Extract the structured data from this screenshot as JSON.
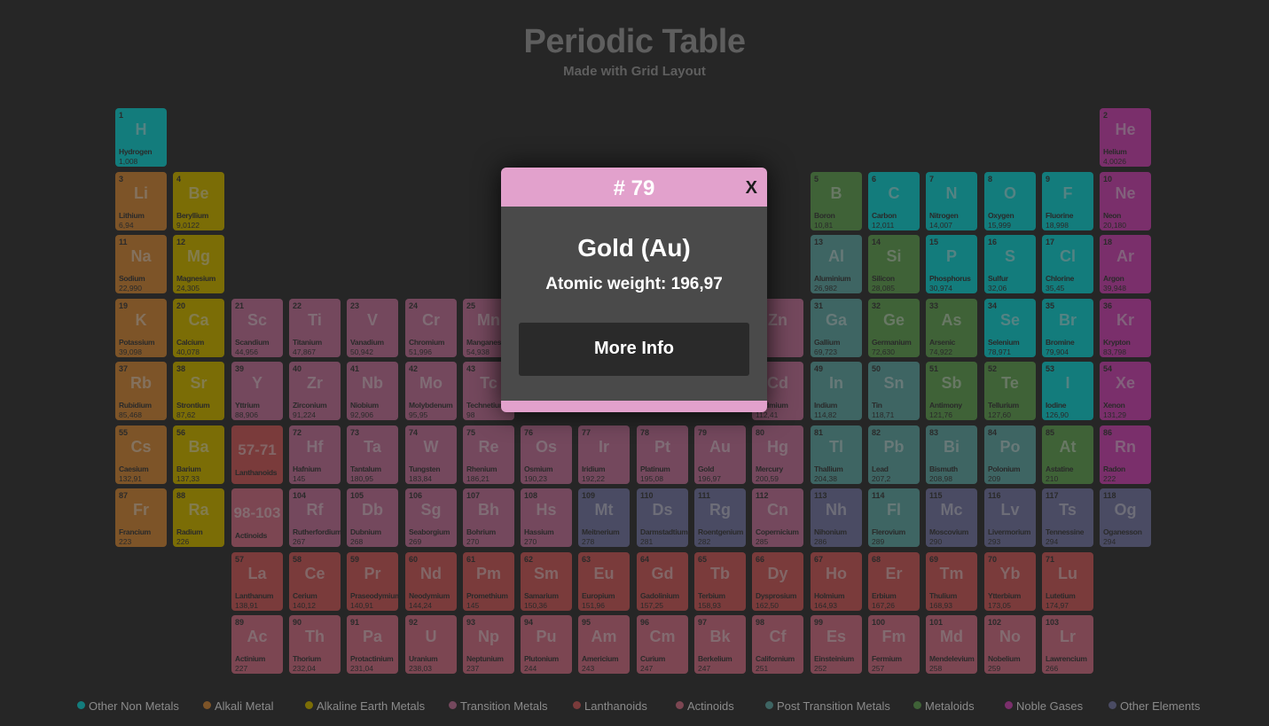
{
  "header": {
    "title": "Periodic Table",
    "subtitle": "Made with Grid Layout"
  },
  "colors": {
    "nonmetal": "#137c7c",
    "alkali": "#7d5428",
    "alkearth": "#7b6d06",
    "transition": "#74485d",
    "lanth": "#7a3b3b",
    "actin": "#7c4652",
    "posttrans": "#3e6563",
    "metalloid": "#3f6237",
    "noble": "#7a2f6b",
    "other": "#4a4b63",
    "modal_accent": "#e2a1cc"
  },
  "elements": [
    {
      "n": "1",
      "s": "H",
      "name": "Hydrogen",
      "w": "1,008",
      "col": 1,
      "row": 1,
      "cat": "nonmetal"
    },
    {
      "n": "2",
      "s": "He",
      "name": "Helium",
      "w": "4,0026",
      "col": 18,
      "row": 1,
      "cat": "noble"
    },
    {
      "n": "3",
      "s": "Li",
      "name": "Lithium",
      "w": "6,94",
      "col": 1,
      "row": 2,
      "cat": "alkali"
    },
    {
      "n": "4",
      "s": "Be",
      "name": "Beryllium",
      "w": "9,0122",
      "col": 2,
      "row": 2,
      "cat": "alkearth"
    },
    {
      "n": "5",
      "s": "B",
      "name": "Boron",
      "w": "10,81",
      "col": 13,
      "row": 2,
      "cat": "metalloid"
    },
    {
      "n": "6",
      "s": "C",
      "name": "Carbon",
      "w": "12,011",
      "col": 14,
      "row": 2,
      "cat": "nonmetal"
    },
    {
      "n": "7",
      "s": "N",
      "name": "Nitrogen",
      "w": "14,007",
      "col": 15,
      "row": 2,
      "cat": "nonmetal"
    },
    {
      "n": "8",
      "s": "O",
      "name": "Oxygen",
      "w": "15,999",
      "col": 16,
      "row": 2,
      "cat": "nonmetal"
    },
    {
      "n": "9",
      "s": "F",
      "name": "Fluorine",
      "w": "18,998",
      "col": 17,
      "row": 2,
      "cat": "nonmetal"
    },
    {
      "n": "10",
      "s": "Ne",
      "name": "Neon",
      "w": "20,180",
      "col": 18,
      "row": 2,
      "cat": "noble"
    },
    {
      "n": "11",
      "s": "Na",
      "name": "Sodium",
      "w": "22,990",
      "col": 1,
      "row": 3,
      "cat": "alkali"
    },
    {
      "n": "12",
      "s": "Mg",
      "name": "Magnesium",
      "w": "24,305",
      "col": 2,
      "row": 3,
      "cat": "alkearth"
    },
    {
      "n": "13",
      "s": "Al",
      "name": "Aluminium",
      "w": "26,982",
      "col": 13,
      "row": 3,
      "cat": "posttrans"
    },
    {
      "n": "14",
      "s": "Si",
      "name": "Silicon",
      "w": "28,085",
      "col": 14,
      "row": 3,
      "cat": "metalloid"
    },
    {
      "n": "15",
      "s": "P",
      "name": "Phosphorus",
      "w": "30,974",
      "col": 15,
      "row": 3,
      "cat": "nonmetal"
    },
    {
      "n": "16",
      "s": "S",
      "name": "Sulfur",
      "w": "32,06",
      "col": 16,
      "row": 3,
      "cat": "nonmetal"
    },
    {
      "n": "17",
      "s": "Cl",
      "name": "Chlorine",
      "w": "35,45",
      "col": 17,
      "row": 3,
      "cat": "nonmetal"
    },
    {
      "n": "18",
      "s": "Ar",
      "name": "Argon",
      "w": "39,948",
      "col": 18,
      "row": 3,
      "cat": "noble"
    },
    {
      "n": "19",
      "s": "K",
      "name": "Potassium",
      "w": "39,098",
      "col": 1,
      "row": 4,
      "cat": "alkali"
    },
    {
      "n": "20",
      "s": "Ca",
      "name": "Calcium",
      "w": "40,078",
      "col": 2,
      "row": 4,
      "cat": "alkearth"
    },
    {
      "n": "21",
      "s": "Sc",
      "name": "Scandium",
      "w": "44,956",
      "col": 3,
      "row": 4,
      "cat": "transition"
    },
    {
      "n": "22",
      "s": "Ti",
      "name": "Titanium",
      "w": "47,867",
      "col": 4,
      "row": 4,
      "cat": "transition"
    },
    {
      "n": "23",
      "s": "V",
      "name": "Vanadium",
      "w": "50,942",
      "col": 5,
      "row": 4,
      "cat": "transition"
    },
    {
      "n": "24",
      "s": "Cr",
      "name": "Chromium",
      "w": "51,996",
      "col": 6,
      "row": 4,
      "cat": "transition"
    },
    {
      "n": "25",
      "s": "Mn",
      "name": "Manganese",
      "w": "54,938",
      "col": 7,
      "row": 4,
      "cat": "transition"
    },
    {
      "n": "30",
      "s": "Zn",
      "name": "",
      "w": "",
      "col": 12,
      "row": 4,
      "cat": "transition"
    },
    {
      "n": "31",
      "s": "Ga",
      "name": "Gallium",
      "w": "69,723",
      "col": 13,
      "row": 4,
      "cat": "posttrans"
    },
    {
      "n": "32",
      "s": "Ge",
      "name": "Germanium",
      "w": "72,630",
      "col": 14,
      "row": 4,
      "cat": "metalloid"
    },
    {
      "n": "33",
      "s": "As",
      "name": "Arsenic",
      "w": "74,922",
      "col": 15,
      "row": 4,
      "cat": "metalloid"
    },
    {
      "n": "34",
      "s": "Se",
      "name": "Selenium",
      "w": "78,971",
      "col": 16,
      "row": 4,
      "cat": "nonmetal"
    },
    {
      "n": "35",
      "s": "Br",
      "name": "Bromine",
      "w": "79,904",
      "col": 17,
      "row": 4,
      "cat": "nonmetal"
    },
    {
      "n": "36",
      "s": "Kr",
      "name": "Krypton",
      "w": "83,798",
      "col": 18,
      "row": 4,
      "cat": "noble"
    },
    {
      "n": "37",
      "s": "Rb",
      "name": "Rubidium",
      "w": "85,468",
      "col": 1,
      "row": 5,
      "cat": "alkali"
    },
    {
      "n": "38",
      "s": "Sr",
      "name": "Strontium",
      "w": "87,62",
      "col": 2,
      "row": 5,
      "cat": "alkearth"
    },
    {
      "n": "39",
      "s": "Y",
      "name": "Yttrium",
      "w": "88,906",
      "col": 3,
      "row": 5,
      "cat": "transition"
    },
    {
      "n": "40",
      "s": "Zr",
      "name": "Zirconium",
      "w": "91,224",
      "col": 4,
      "row": 5,
      "cat": "transition"
    },
    {
      "n": "41",
      "s": "Nb",
      "name": "Niobium",
      "w": "92,906",
      "col": 5,
      "row": 5,
      "cat": "transition"
    },
    {
      "n": "42",
      "s": "Mo",
      "name": "Molybdenum",
      "w": "95,95",
      "col": 6,
      "row": 5,
      "cat": "transition"
    },
    {
      "n": "43",
      "s": "Tc",
      "name": "Technetium",
      "w": "98",
      "col": 7,
      "row": 5,
      "cat": "transition"
    },
    {
      "n": "48",
      "s": "Cd",
      "name": "Cadmium",
      "w": "112,41",
      "col": 12,
      "row": 5,
      "cat": "transition"
    },
    {
      "n": "49",
      "s": "In",
      "name": "Indium",
      "w": "114,82",
      "col": 13,
      "row": 5,
      "cat": "posttrans"
    },
    {
      "n": "50",
      "s": "Sn",
      "name": "Tin",
      "w": "118,71",
      "col": 14,
      "row": 5,
      "cat": "posttrans"
    },
    {
      "n": "51",
      "s": "Sb",
      "name": "Antimony",
      "w": "121,76",
      "col": 15,
      "row": 5,
      "cat": "metalloid"
    },
    {
      "n": "52",
      "s": "Te",
      "name": "Tellurium",
      "w": "127,60",
      "col": 16,
      "row": 5,
      "cat": "metalloid"
    },
    {
      "n": "53",
      "s": "I",
      "name": "Iodine",
      "w": "126,90",
      "col": 17,
      "row": 5,
      "cat": "nonmetal"
    },
    {
      "n": "54",
      "s": "Xe",
      "name": "Xenon",
      "w": "131,29",
      "col": 18,
      "row": 5,
      "cat": "noble"
    },
    {
      "n": "55",
      "s": "Cs",
      "name": "Caesium",
      "w": "132,91",
      "col": 1,
      "row": 6,
      "cat": "alkali"
    },
    {
      "n": "56",
      "s": "Ba",
      "name": "Barium",
      "w": "137,33",
      "col": 2,
      "row": 6,
      "cat": "alkearth"
    },
    {
      "n": "",
      "s": "57-71",
      "name": "Lanthanoids",
      "w": "",
      "col": 3,
      "row": 6,
      "cat": "lanth",
      "range": true
    },
    {
      "n": "72",
      "s": "Hf",
      "name": "Hafnium",
      "w": "145",
      "col": 4,
      "row": 6,
      "cat": "transition"
    },
    {
      "n": "73",
      "s": "Ta",
      "name": "Tantalum",
      "w": "180,95",
      "col": 5,
      "row": 6,
      "cat": "transition"
    },
    {
      "n": "74",
      "s": "W",
      "name": "Tungsten",
      "w": "183,84",
      "col": 6,
      "row": 6,
      "cat": "transition"
    },
    {
      "n": "75",
      "s": "Re",
      "name": "Rhenium",
      "w": "186,21",
      "col": 7,
      "row": 6,
      "cat": "transition"
    },
    {
      "n": "76",
      "s": "Os",
      "name": "Osmium",
      "w": "190,23",
      "col": 8,
      "row": 6,
      "cat": "transition"
    },
    {
      "n": "77",
      "s": "Ir",
      "name": "Iridium",
      "w": "192,22",
      "col": 9,
      "row": 6,
      "cat": "transition"
    },
    {
      "n": "78",
      "s": "Pt",
      "name": "Platinum",
      "w": "195,08",
      "col": 10,
      "row": 6,
      "cat": "transition"
    },
    {
      "n": "79",
      "s": "Au",
      "name": "Gold",
      "w": "196,97",
      "col": 11,
      "row": 6,
      "cat": "transition"
    },
    {
      "n": "80",
      "s": "Hg",
      "name": "Mercury",
      "w": "200,59",
      "col": 12,
      "row": 6,
      "cat": "transition"
    },
    {
      "n": "81",
      "s": "Tl",
      "name": "Thallium",
      "w": "204,38",
      "col": 13,
      "row": 6,
      "cat": "posttrans"
    },
    {
      "n": "82",
      "s": "Pb",
      "name": "Lead",
      "w": "207,2",
      "col": 14,
      "row": 6,
      "cat": "posttrans"
    },
    {
      "n": "83",
      "s": "Bi",
      "name": "Bismuth",
      "w": "208,98",
      "col": 15,
      "row": 6,
      "cat": "posttrans"
    },
    {
      "n": "84",
      "s": "Po",
      "name": "Polonium",
      "w": "209",
      "col": 16,
      "row": 6,
      "cat": "posttrans"
    },
    {
      "n": "85",
      "s": "At",
      "name": "Astatine",
      "w": "210",
      "col": 17,
      "row": 6,
      "cat": "metalloid"
    },
    {
      "n": "86",
      "s": "Rn",
      "name": "Radon",
      "w": "222",
      "col": 18,
      "row": 6,
      "cat": "noble"
    },
    {
      "n": "87",
      "s": "Fr",
      "name": "Francium",
      "w": "223",
      "col": 1,
      "row": 7,
      "cat": "alkali"
    },
    {
      "n": "88",
      "s": "Ra",
      "name": "Radium",
      "w": "226",
      "col": 2,
      "row": 7,
      "cat": "alkearth"
    },
    {
      "n": "",
      "s": "98-103",
      "name": "Actinoids",
      "w": "",
      "col": 3,
      "row": 7,
      "cat": "actin",
      "range": true
    },
    {
      "n": "104",
      "s": "Rf",
      "name": "Rutherfordium",
      "w": "267",
      "col": 4,
      "row": 7,
      "cat": "transition"
    },
    {
      "n": "105",
      "s": "Db",
      "name": "Dubnium",
      "w": "268",
      "col": 5,
      "row": 7,
      "cat": "transition"
    },
    {
      "n": "106",
      "s": "Sg",
      "name": "Seaborgium",
      "w": "269",
      "col": 6,
      "row": 7,
      "cat": "transition"
    },
    {
      "n": "107",
      "s": "Bh",
      "name": "Bohrium",
      "w": "270",
      "col": 7,
      "row": 7,
      "cat": "transition"
    },
    {
      "n": "108",
      "s": "Hs",
      "name": "Hassium",
      "w": "270",
      "col": 8,
      "row": 7,
      "cat": "transition"
    },
    {
      "n": "109",
      "s": "Mt",
      "name": "Meitnerium",
      "w": "278",
      "col": 9,
      "row": 7,
      "cat": "other"
    },
    {
      "n": "110",
      "s": "Ds",
      "name": "Darmstadtium",
      "w": "281",
      "col": 10,
      "row": 7,
      "cat": "other"
    },
    {
      "n": "111",
      "s": "Rg",
      "name": "Roentgenium",
      "w": "282",
      "col": 11,
      "row": 7,
      "cat": "other"
    },
    {
      "n": "112",
      "s": "Cn",
      "name": "Copernicium",
      "w": "285",
      "col": 12,
      "row": 7,
      "cat": "transition"
    },
    {
      "n": "113",
      "s": "Nh",
      "name": "Nihonium",
      "w": "286",
      "col": 13,
      "row": 7,
      "cat": "other"
    },
    {
      "n": "114",
      "s": "Fl",
      "name": "Flerovium",
      "w": "289",
      "col": 14,
      "row": 7,
      "cat": "posttrans"
    },
    {
      "n": "115",
      "s": "Mc",
      "name": "Moscovium",
      "w": "290",
      "col": 15,
      "row": 7,
      "cat": "other"
    },
    {
      "n": "116",
      "s": "Lv",
      "name": "Livermorium",
      "w": "293",
      "col": 16,
      "row": 7,
      "cat": "other"
    },
    {
      "n": "117",
      "s": "Ts",
      "name": "Tennessine",
      "w": "294",
      "col": 17,
      "row": 7,
      "cat": "other"
    },
    {
      "n": "118",
      "s": "Og",
      "name": "Oganesson",
      "w": "294",
      "col": 18,
      "row": 7,
      "cat": "other"
    },
    {
      "n": "57",
      "s": "La",
      "name": "Lanthanum",
      "w": "138,91",
      "col": 3,
      "row": 8,
      "cat": "lanth"
    },
    {
      "n": "58",
      "s": "Ce",
      "name": "Cerium",
      "w": "140,12",
      "col": 4,
      "row": 8,
      "cat": "lanth"
    },
    {
      "n": "59",
      "s": "Pr",
      "name": "Praseodymium",
      "w": "140,91",
      "col": 5,
      "row": 8,
      "cat": "lanth"
    },
    {
      "n": "60",
      "s": "Nd",
      "name": "Neodymium",
      "w": "144,24",
      "col": 6,
      "row": 8,
      "cat": "lanth"
    },
    {
      "n": "61",
      "s": "Pm",
      "name": "Promethium",
      "w": "145",
      "col": 7,
      "row": 8,
      "cat": "lanth"
    },
    {
      "n": "62",
      "s": "Sm",
      "name": "Samarium",
      "w": "150,36",
      "col": 8,
      "row": 8,
      "cat": "lanth"
    },
    {
      "n": "63",
      "s": "Eu",
      "name": "Europium",
      "w": "151,96",
      "col": 9,
      "row": 8,
      "cat": "lanth"
    },
    {
      "n": "64",
      "s": "Gd",
      "name": "Gadolinium",
      "w": "157,25",
      "col": 10,
      "row": 8,
      "cat": "lanth"
    },
    {
      "n": "65",
      "s": "Tb",
      "name": "Terbium",
      "w": "158,93",
      "col": 11,
      "row": 8,
      "cat": "lanth"
    },
    {
      "n": "66",
      "s": "Dy",
      "name": "Dysprosium",
      "w": "162,50",
      "col": 12,
      "row": 8,
      "cat": "lanth"
    },
    {
      "n": "67",
      "s": "Ho",
      "name": "Holmium",
      "w": "164,93",
      "col": 13,
      "row": 8,
      "cat": "lanth"
    },
    {
      "n": "68",
      "s": "Er",
      "name": "Erbium",
      "w": "167,26",
      "col": 14,
      "row": 8,
      "cat": "lanth"
    },
    {
      "n": "69",
      "s": "Tm",
      "name": "Thulium",
      "w": "168,93",
      "col": 15,
      "row": 8,
      "cat": "lanth"
    },
    {
      "n": "70",
      "s": "Yb",
      "name": "Ytterbium",
      "w": "173,05",
      "col": 16,
      "row": 8,
      "cat": "lanth"
    },
    {
      "n": "71",
      "s": "Lu",
      "name": "Lutetium",
      "w": "174,97",
      "col": 17,
      "row": 8,
      "cat": "lanth"
    },
    {
      "n": "89",
      "s": "Ac",
      "name": "Actinium",
      "w": "227",
      "col": 3,
      "row": 9,
      "cat": "actin"
    },
    {
      "n": "90",
      "s": "Th",
      "name": "Thorium",
      "w": "232,04",
      "col": 4,
      "row": 9,
      "cat": "actin"
    },
    {
      "n": "91",
      "s": "Pa",
      "name": "Protactinium",
      "w": "231,04",
      "col": 5,
      "row": 9,
      "cat": "actin"
    },
    {
      "n": "92",
      "s": "U",
      "name": "Uranium",
      "w": "238,03",
      "col": 6,
      "row": 9,
      "cat": "actin"
    },
    {
      "n": "93",
      "s": "Np",
      "name": "Neptunium",
      "w": "237",
      "col": 7,
      "row": 9,
      "cat": "actin"
    },
    {
      "n": "94",
      "s": "Pu",
      "name": "Plutonium",
      "w": "244",
      "col": 8,
      "row": 9,
      "cat": "actin"
    },
    {
      "n": "95",
      "s": "Am",
      "name": "Americium",
      "w": "243",
      "col": 9,
      "row": 9,
      "cat": "actin"
    },
    {
      "n": "96",
      "s": "Cm",
      "name": "Curium",
      "w": "247",
      "col": 10,
      "row": 9,
      "cat": "actin"
    },
    {
      "n": "97",
      "s": "Bk",
      "name": "Berkelium",
      "w": "247",
      "col": 11,
      "row": 9,
      "cat": "actin"
    },
    {
      "n": "98",
      "s": "Cf",
      "name": "Californium",
      "w": "251",
      "col": 12,
      "row": 9,
      "cat": "actin"
    },
    {
      "n": "99",
      "s": "Es",
      "name": "Einsteinium",
      "w": "252",
      "col": 13,
      "row": 9,
      "cat": "actin"
    },
    {
      "n": "100",
      "s": "Fm",
      "name": "Fermium",
      "w": "257",
      "col": 14,
      "row": 9,
      "cat": "actin"
    },
    {
      "n": "101",
      "s": "Md",
      "name": "Mendelevium",
      "w": "258",
      "col": 15,
      "row": 9,
      "cat": "actin"
    },
    {
      "n": "102",
      "s": "No",
      "name": "Nobelium",
      "w": "259",
      "col": 16,
      "row": 9,
      "cat": "actin"
    },
    {
      "n": "103",
      "s": "Lr",
      "name": "Lawrencium",
      "w": "266",
      "col": 17,
      "row": 9,
      "cat": "actin"
    }
  ],
  "legend": [
    {
      "label": "Other Non Metals",
      "cat": "nonmetal"
    },
    {
      "label": "Alkali Metal",
      "cat": "alkali"
    },
    {
      "label": "Alkaline Earth Metals",
      "cat": "alkearth"
    },
    {
      "label": "Transition Metals",
      "cat": "transition"
    },
    {
      "label": "Lanthanoids",
      "cat": "lanth"
    },
    {
      "label": "Actinoids",
      "cat": "actin"
    },
    {
      "label": "Post Transition Metals",
      "cat": "posttrans"
    },
    {
      "label": "Metaloids",
      "cat": "metalloid"
    },
    {
      "label": "Noble Gases",
      "cat": "noble"
    },
    {
      "label": "Other Elements",
      "cat": "other"
    }
  ],
  "modal": {
    "number": "# 79",
    "close_label": "X",
    "title": "Gold (Au)",
    "weight": "Atomic weight: 196,97",
    "button_label": "More Info"
  }
}
